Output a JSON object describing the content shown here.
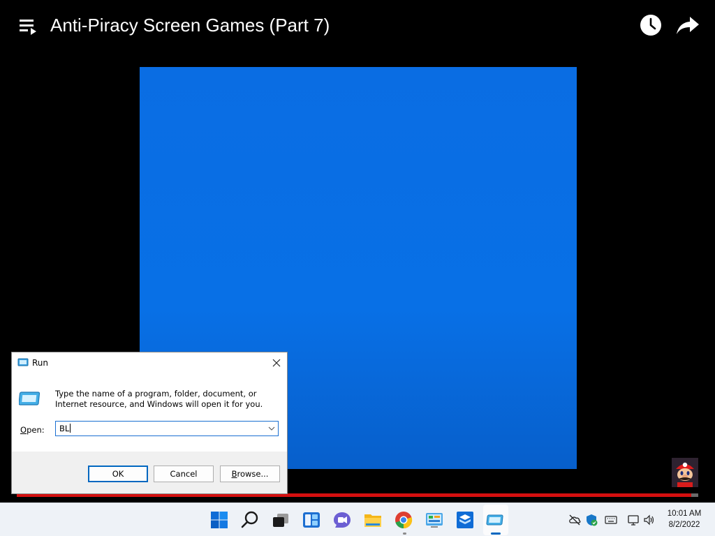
{
  "video": {
    "title": "Anti-Piracy Screen Games (Part 7)",
    "progress_fraction": 0.99
  },
  "icons": {
    "playlist": "playlist-icon",
    "watch_later": "clock-icon",
    "share": "share-arrow-icon",
    "channel": "mario-avatar-icon"
  },
  "colors": {
    "video_blue": "#0a6de3",
    "progress_red": "#d40f0f",
    "accent": "#0067c0"
  },
  "run_dialog": {
    "title": "Run",
    "description": "Type the name of a program, folder, document, or Internet resource, and Windows will open it for you.",
    "open_label_prefix": "",
    "open_label_underlined": "O",
    "open_label_rest": "pen:",
    "input_value": "BL",
    "ok_label": "OK",
    "cancel_label": "Cancel",
    "browse_label_underlined": "B",
    "browse_label_rest": "rowse..."
  },
  "taskbar": {
    "apps": [
      "windows-start-icon",
      "search-icon",
      "task-view-icon",
      "widgets-icon",
      "chat-icon",
      "file-explorer-icon",
      "chrome-icon",
      "control-panel-icon",
      "virtualbox-icon",
      "run-app-icon"
    ],
    "tray": [
      "onedrive-icon",
      "security-icon",
      "keyboard-icon",
      "network-icon",
      "volume-icon"
    ],
    "time": "10:01 AM",
    "date": "8/2/2022"
  }
}
